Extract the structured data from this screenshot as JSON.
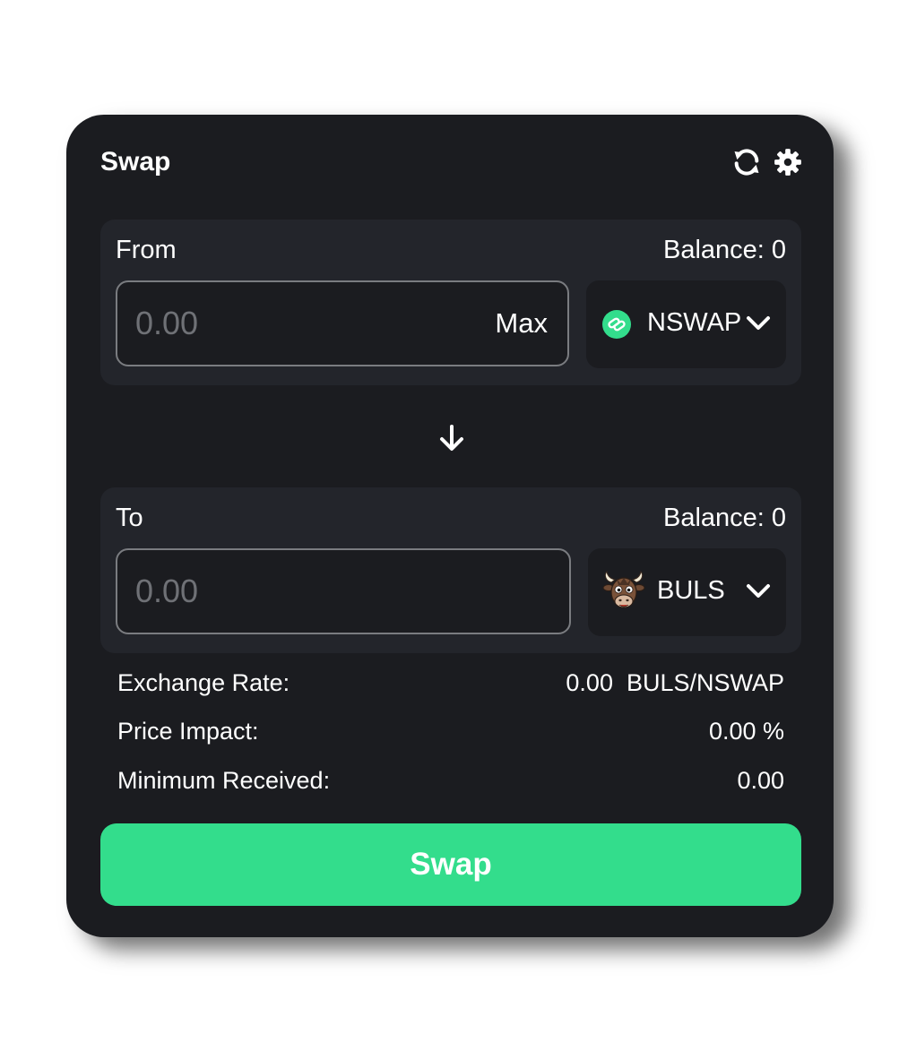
{
  "header": {
    "title": "Swap",
    "icons": [
      "refresh-icon",
      "gear-icon"
    ]
  },
  "from": {
    "label": "From",
    "balance_label": "Balance:",
    "balance_value": "0",
    "amount_value": "",
    "amount_placeholder": "0.00",
    "max_label": "Max",
    "token": {
      "symbol": "NSWAP",
      "icon": "nswap-token-icon",
      "icon_color": "#33dd8c"
    }
  },
  "switch": {
    "icon": "arrow-down-icon"
  },
  "to": {
    "label": "To",
    "balance_label": "Balance:",
    "balance_value": "0",
    "amount_value": "",
    "amount_placeholder": "0.00",
    "token": {
      "symbol": "BULS",
      "icon": "buls-token-icon"
    }
  },
  "details": {
    "exchange_rate": {
      "label": "Exchange Rate:",
      "value": "0.00  BULS/NSWAP"
    },
    "price_impact": {
      "label": "Price Impact:",
      "value": "0.00 %"
    },
    "minimum_received": {
      "label": "Minimum Received:",
      "value": "0.00"
    }
  },
  "action": {
    "swap_label": "Swap",
    "accent_color": "#33dd8c"
  },
  "colors": {
    "card_background": "#1b1c20",
    "panel_background": "#23252b",
    "text": "#ffffff",
    "placeholder": "#6f7176"
  }
}
